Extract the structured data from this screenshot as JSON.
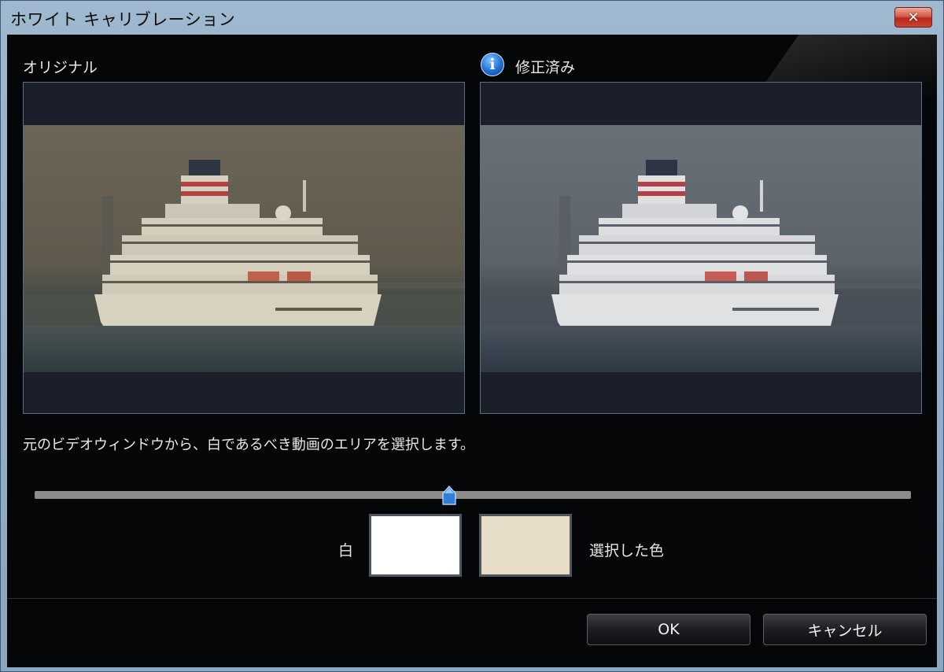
{
  "window": {
    "title": "ホワイト キャリブレーション"
  },
  "panels": {
    "original_label": "オリジナル",
    "corrected_label": "修正済み"
  },
  "instruction": "元のビデオウィンドウから、白であるべき動画のエリアを選択します。",
  "slider": {
    "value_fraction": 0.473
  },
  "swatches": {
    "white_label": "白",
    "selected_label": "選択した色",
    "white_color": "#ffffff",
    "selected_color": "#e6dcc7"
  },
  "buttons": {
    "ok": "OK",
    "cancel": "キャンセル"
  },
  "colors": {
    "accent": "#1f6fd1",
    "close": "#c9412f"
  }
}
